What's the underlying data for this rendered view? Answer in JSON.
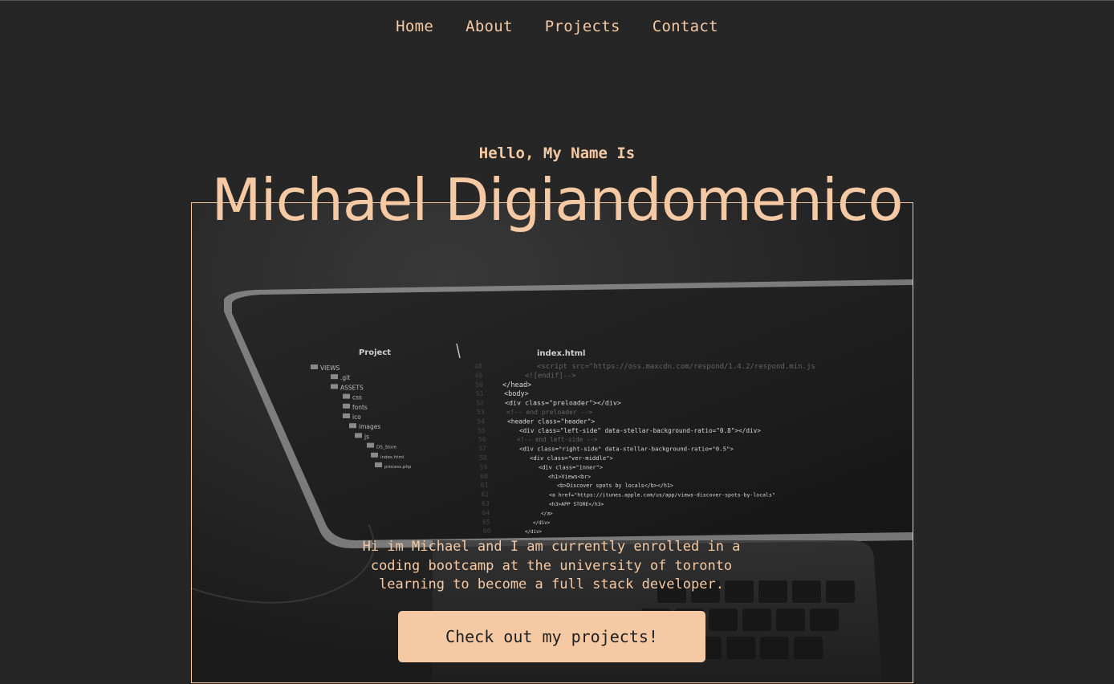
{
  "nav": {
    "items": [
      "Home",
      "About",
      "Projects",
      "Contact"
    ]
  },
  "hero": {
    "greeting": "Hello, My Name Is",
    "name": "Michael Digiandomenico",
    "bio": "Hi im Michael and I am currently enrolled in a coding bootcamp at the university of toronto learning to become a full stack developer.",
    "cta_label": "Check out my projects!"
  },
  "background_image": {
    "subject": "laptop showing code editor",
    "editor_sidebar_title": "Project",
    "editor_tab_title": "index.html",
    "tree_items": [
      "VIEWS",
      ".git",
      "ASSETS",
      "css",
      "fonts",
      "ico",
      "images",
      "js",
      "DS_Store",
      "index.html",
      "process.php"
    ],
    "code_lines": [
      "<script src=\"https://oss.maxcdn.com/respond/1.4.2/respond.min.js",
      "<![endif]-->",
      "</head>",
      "<body>",
      "<div class=\"preloader\"></div>",
      "<!-- end preloader -->",
      "<header class=\"header\">",
      "<div class=\"left-side\" data-stellar-background-ratio=\"0.8\"></div>",
      "<!-- end left-side -->",
      "<div class=\"right-side\" data-stellar-background-ratio=\"0.5\">",
      "<div class=\"ver-middle\">",
      "<div class=\"inner\">",
      "<h1>Views<br>",
      "<b>Discover spots by locals</b></h1>",
      "<a href=\"https://itunes.apple.com/us/app/views-discover-spots-by-locals\"",
      "<h3>APP STORE</h3>",
      "</a>",
      "</div>",
      "</div>"
    ],
    "line_numbers": [
      "48",
      "49",
      "50",
      "51",
      "52",
      "53",
      "54",
      "55",
      "56",
      "57",
      "58",
      "59",
      "60",
      "61",
      "62",
      "63",
      "64",
      "65",
      "66"
    ]
  },
  "colors": {
    "background": "#262626",
    "accent": "#f5c9a3",
    "button_text": "#1e1e1e"
  }
}
